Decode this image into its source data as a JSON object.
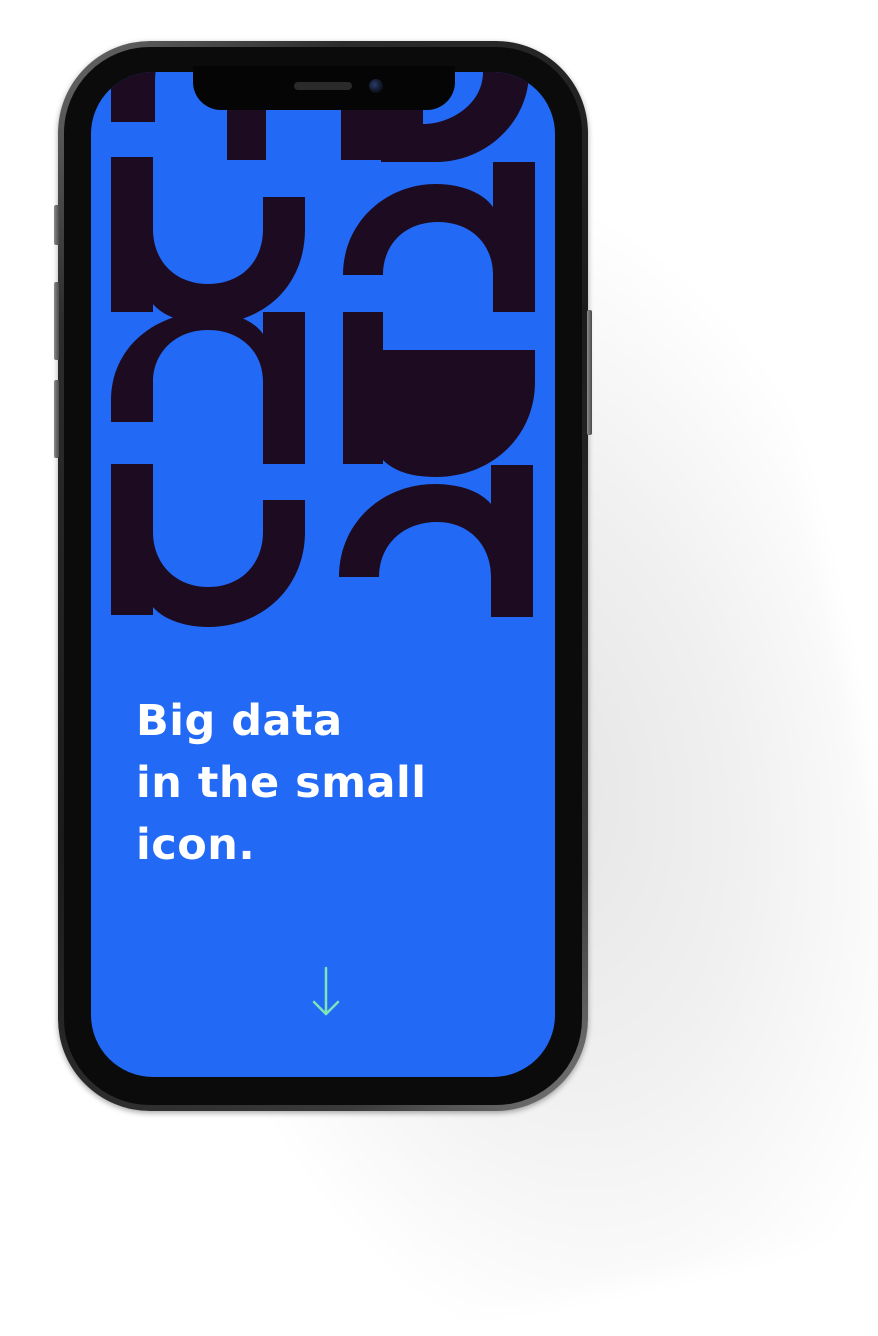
{
  "hero": {
    "headline_lines": [
      "Big data",
      "in the small",
      "icon."
    ]
  },
  "scroll_arrow": {
    "icon": "arrow-down-icon",
    "color": "#7fe3b8"
  },
  "colors": {
    "background": "#226af5",
    "pattern": "#1d0b22",
    "text": "#ffffff"
  }
}
